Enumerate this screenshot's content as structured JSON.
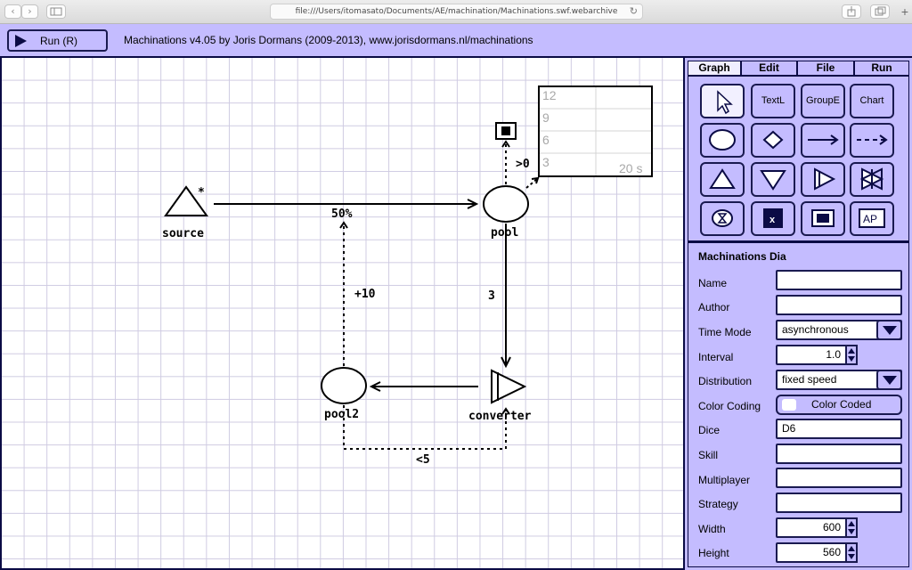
{
  "browser": {
    "url": "file:///Users/itomasato/Documents/AE/machination/Machinations.swf.webarchive"
  },
  "toolbar": {
    "run_label": "Run (R)",
    "title": "Machinations v4.05 by Joris Dormans (2009-2013), www.jorisdormans.nl/machinations"
  },
  "diagram": {
    "nodes": {
      "source": "source",
      "source_trigger": "*",
      "pool": "pool",
      "pool2": "pool2",
      "converter": "converter"
    },
    "edges": {
      "source_to_pool": "50%",
      "pool_to_chart": ">0",
      "pool_to_converter": "3",
      "pool2_to_flow": "+10",
      "converter_to_pool2": "<5"
    },
    "chart": {
      "ticks": [
        "12",
        "9",
        "6",
        "3"
      ],
      "time_label": "20 s"
    }
  },
  "panel": {
    "tabs": [
      "Graph",
      "Edit",
      "File",
      "Run"
    ],
    "active_tab": "Graph",
    "tools": {
      "text": "TextL",
      "group": "GroupE",
      "chart": "Chart",
      "ap": "AP",
      "end": "x"
    },
    "props": {
      "title": "Machinations Dia",
      "name_label": "Name",
      "name_value": "",
      "author_label": "Author",
      "author_value": "",
      "time_mode_label": "Time Mode",
      "time_mode_value": "asynchronous",
      "interval_label": "Interval",
      "interval_value": "1.0",
      "distribution_label": "Distribution",
      "distribution_value": "fixed speed",
      "color_coding_label": "Color Coding",
      "color_coding_value": "Color Coded",
      "dice_label": "Dice",
      "dice_value": "D6",
      "skill_label": "Skill",
      "skill_value": "",
      "multiplayer_label": "Multiplayer",
      "multiplayer_value": "",
      "strategy_label": "Strategy",
      "strategy_value": "",
      "width_label": "Width",
      "width_value": "600",
      "height_label": "Height",
      "height_value": "560"
    }
  },
  "colors": {
    "panel_bg": "#c4bcff",
    "dark_navy": "#0b0b45",
    "grid": "#cfcbe2"
  }
}
